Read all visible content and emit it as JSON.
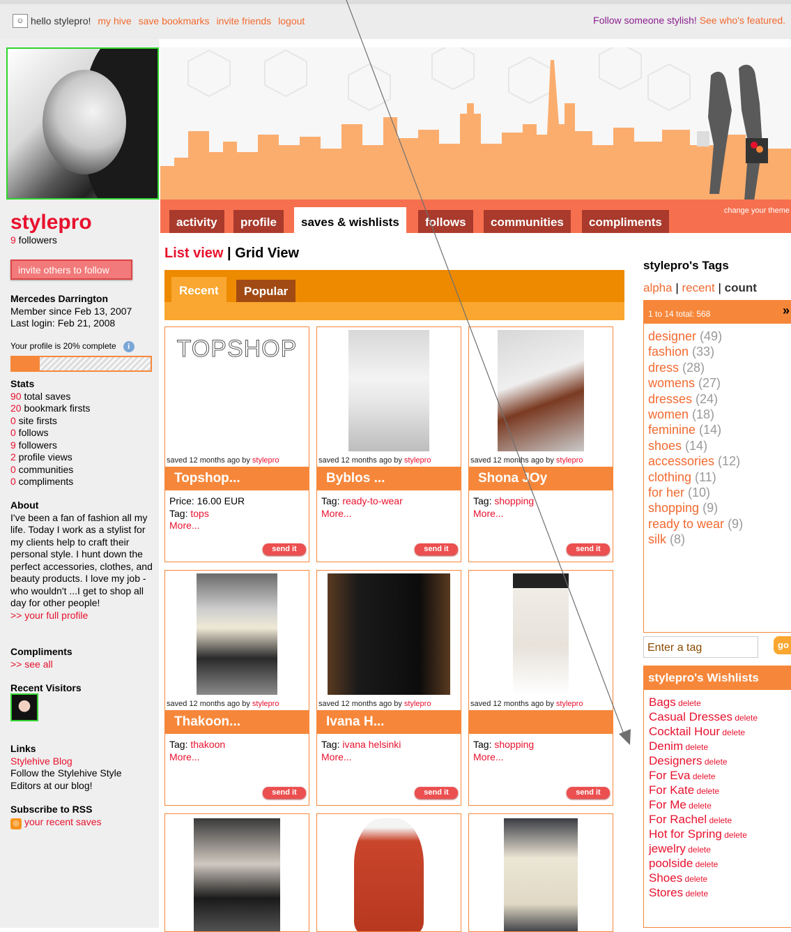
{
  "topbar": {
    "greeting": "hello stylepro!",
    "links": [
      "my hive",
      "save bookmarks",
      "invite friends",
      "logout"
    ],
    "promo_text": "Follow someone stylish!",
    "promo_link": "See who's featured."
  },
  "tabs": [
    "activity",
    "profile",
    "saves & wishlists",
    "follows",
    "communities",
    "compliments"
  ],
  "active_tab": "saves & wishlists",
  "change_theme": "change your theme",
  "sidebar": {
    "username": "stylepro",
    "followers_count": "9",
    "followers_label": " followers",
    "invite_button": "invite others to follow",
    "full_name": "Mercedes Darrington",
    "member_since": "Member since Feb 13, 2007",
    "last_login": "Last login: Feb 21, 2008",
    "profile_complete": "Your profile is 20% complete",
    "profile_complete_fraction": 0.2,
    "stats_title": "Stats",
    "stats": [
      {
        "num": "90",
        "label": " total saves"
      },
      {
        "num": "20",
        "label": " bookmark firsts"
      },
      {
        "num": "0",
        "label": " site firsts"
      },
      {
        "num": "0",
        "label": " follows"
      },
      {
        "num": "9",
        "label": " followers"
      },
      {
        "num": "2",
        "label": " profile views"
      },
      {
        "num": "0",
        "label": " communities"
      },
      {
        "num": "0",
        "label": " compliments"
      }
    ],
    "about_title": "About",
    "about_text": "I've been a fan of fashion all my life. Today I work as a stylist for my clients help to craft their personal style. I hunt down the perfect accessories, clothes, and beauty products. I love my job - who wouldn't ...I get to shop all day for other people!",
    "full_profile_link": ">> your full profile",
    "compliments_title": "Compliments",
    "see_all_link": ">> see all",
    "visitors_title": "Recent Visitors",
    "links_title": "Links",
    "blog_link": "Stylehive Blog",
    "blog_desc": "Follow the Stylehive Style Editors at our blog!",
    "rss_title": "Subscribe to RSS",
    "rss_link": "your recent saves"
  },
  "main": {
    "list_view": "List view",
    "separator": " | ",
    "grid_view": "Grid View",
    "filter_tabs": [
      "Recent",
      "Popular"
    ],
    "cards": [
      {
        "title": "Topshop...",
        "saved": "saved 12 months ago by ",
        "by": "stylepro",
        "line1_label": "Price: 16.00 EUR",
        "line1_value": "",
        "line2_label": "Tag: ",
        "line2_value": "tops",
        "more": "More...",
        "send": "send it",
        "image_text": "TOPSHOP"
      },
      {
        "title": "Byblos ...",
        "saved": "saved 12 months ago by ",
        "by": "stylepro",
        "line1_label": "Tag: ",
        "line1_value": "ready-to-wear",
        "more": "More...",
        "send": "send it"
      },
      {
        "title": "Shona JOy",
        "saved": "saved 12 months ago by ",
        "by": "stylepro",
        "line1_label": "Tag: ",
        "line1_value": "shopping",
        "more": "More...",
        "send": "send it"
      },
      {
        "title": "Thakoon...",
        "saved": "saved 12 months ago by ",
        "by": "stylepro",
        "line1_label": "Tag: ",
        "line1_value": "thakoon",
        "more": "More...",
        "send": "send it"
      },
      {
        "title": "Ivana H...",
        "saved": "saved 12 months ago by ",
        "by": "stylepro",
        "line1_label": "Tag: ",
        "line1_value": "ivana helsinki",
        "more": "More...",
        "send": "send it"
      },
      {
        "title": "",
        "saved": "saved 12 months ago by ",
        "by": "stylepro",
        "line1_label": "Tag: ",
        "line1_value": "shopping",
        "more": "More...",
        "send": "send it"
      }
    ]
  },
  "tags": {
    "title": "stylepro's Tags",
    "sort_alpha": "alpha",
    "sort_recent": "recent",
    "sort_count": "count",
    "sep": " | ",
    "header": "1 to 14 total: 568",
    "next": "»",
    "items": [
      {
        "name": "designer",
        "count": " (49)"
      },
      {
        "name": "fashion",
        "count": " (33)"
      },
      {
        "name": "dress",
        "count": " (28)"
      },
      {
        "name": "womens",
        "count": " (27)"
      },
      {
        "name": "dresses",
        "count": " (24)"
      },
      {
        "name": "women",
        "count": " (18)"
      },
      {
        "name": "feminine",
        "count": " (14)"
      },
      {
        "name": "shoes",
        "count": " (14)"
      },
      {
        "name": "accessories",
        "count": " (12)"
      },
      {
        "name": "clothing",
        "count": " (11)"
      },
      {
        "name": "for her",
        "count": " (10)"
      },
      {
        "name": "shopping",
        "count": " (9)"
      },
      {
        "name": "ready to wear",
        "count": " (9)"
      },
      {
        "name": "silk",
        "count": " (8)"
      }
    ],
    "input_placeholder": "Enter a tag",
    "go": "go"
  },
  "wishlists": {
    "title": "stylepro's Wishlists",
    "delete_label": " delete",
    "items": [
      "Bags",
      "Casual Dresses",
      "Cocktail Hour",
      "Denim",
      "Designers",
      "For Eva",
      "For Kate",
      "For Me",
      "For Rachel",
      "Hot for Spring",
      "jewelry",
      "poolside",
      "Shoes",
      "Stores"
    ]
  },
  "colors": {
    "accent_orange": "#f6873a",
    "brand_red": "#e8112d",
    "tab_dark": "#a93a2c",
    "tab_bar": "#f6704f"
  }
}
